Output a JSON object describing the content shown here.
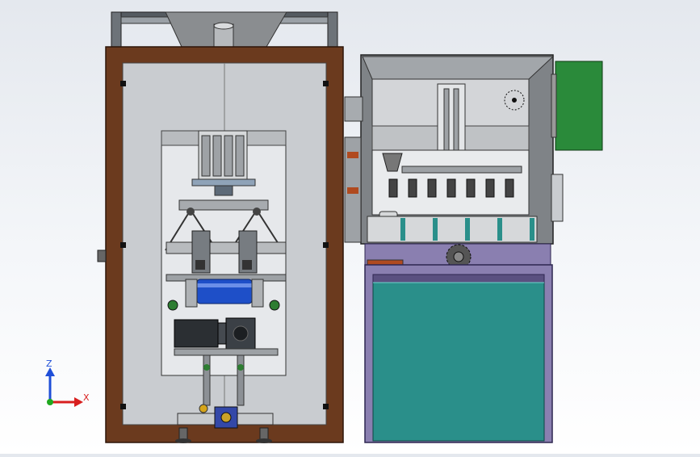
{
  "viewport": {
    "background_top": "#e4e8ee",
    "background_bottom": "#ffffff"
  },
  "model": {
    "frame_color": "#6b3a1e",
    "panel_color": "#c9ccd0",
    "hopper_color": "#8a8d90",
    "motor_color": "#2b2f33",
    "roller_color": "#1e4fc8",
    "cabinet_body_color": "#2a8f8a",
    "cabinet_frame_color": "#8a7fb0",
    "side_motor_color": "#2a8a3a",
    "gear_color": "#555555"
  },
  "triad": {
    "z_label": "Z",
    "x_label": "X",
    "z_color": "#1f4fd8",
    "x_color": "#d81f1f",
    "y_color": "#1fa81f"
  }
}
